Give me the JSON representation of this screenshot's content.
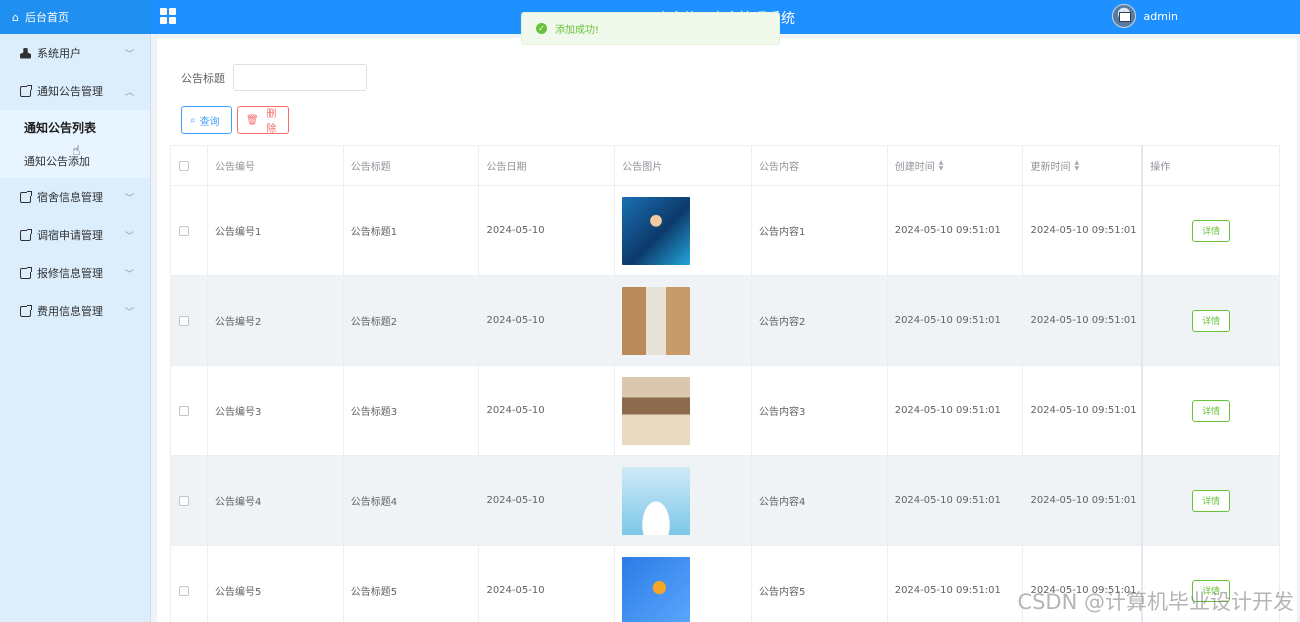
{
  "header": {
    "home_label": "后台首页",
    "system_title": "欢迎使用宿舍管理系统",
    "username": "admin"
  },
  "toast": {
    "message": "添加成功!"
  },
  "sidebar": {
    "items": [
      {
        "label": "系统用户"
      },
      {
        "label": "通知公告管理"
      },
      {
        "label": "宿舍信息管理"
      },
      {
        "label": "调宿申请管理"
      },
      {
        "label": "报修信息管理"
      },
      {
        "label": "费用信息管理"
      }
    ],
    "submenu": [
      {
        "label": "通知公告列表"
      },
      {
        "label": "通知公告添加"
      }
    ]
  },
  "search": {
    "label": "公告标题",
    "value": ""
  },
  "buttons": {
    "query": "查询",
    "delete": "删除"
  },
  "table": {
    "headers": [
      "公告编号",
      "公告标题",
      "公告日期",
      "公告图片",
      "公告内容",
      "创建时间",
      "更新时间",
      "操作"
    ],
    "detail_label": "详情",
    "rows": [
      {
        "id": "公告编号1",
        "title": "公告标题1",
        "date": "2024-05-10",
        "content": "公告内容1",
        "created": "2024-05-10 09:51:01",
        "updated": "2024-05-10 09:51:01"
      },
      {
        "id": "公告编号2",
        "title": "公告标题2",
        "date": "2024-05-10",
        "content": "公告内容2",
        "created": "2024-05-10 09:51:01",
        "updated": "2024-05-10 09:51:01"
      },
      {
        "id": "公告编号3",
        "title": "公告标题3",
        "date": "2024-05-10",
        "content": "公告内容3",
        "created": "2024-05-10 09:51:01",
        "updated": "2024-05-10 09:51:01"
      },
      {
        "id": "公告编号4",
        "title": "公告标题4",
        "date": "2024-05-10",
        "content": "公告内容4",
        "created": "2024-05-10 09:51:01",
        "updated": "2024-05-10 09:51:01"
      },
      {
        "id": "公告编号5",
        "title": "公告标题5",
        "date": "2024-05-10",
        "content": "公告内容5",
        "created": "2024-05-10 09:51:01",
        "updated": "2024-05-10 09:51:01"
      }
    ]
  },
  "watermark": "CSDN @计算机毕业设计开发",
  "colors": {
    "header": "#1e90ff",
    "sidebar": "#dceefc",
    "query": "#409eff",
    "delete": "#f56c6c",
    "detail": "#67c23a"
  }
}
